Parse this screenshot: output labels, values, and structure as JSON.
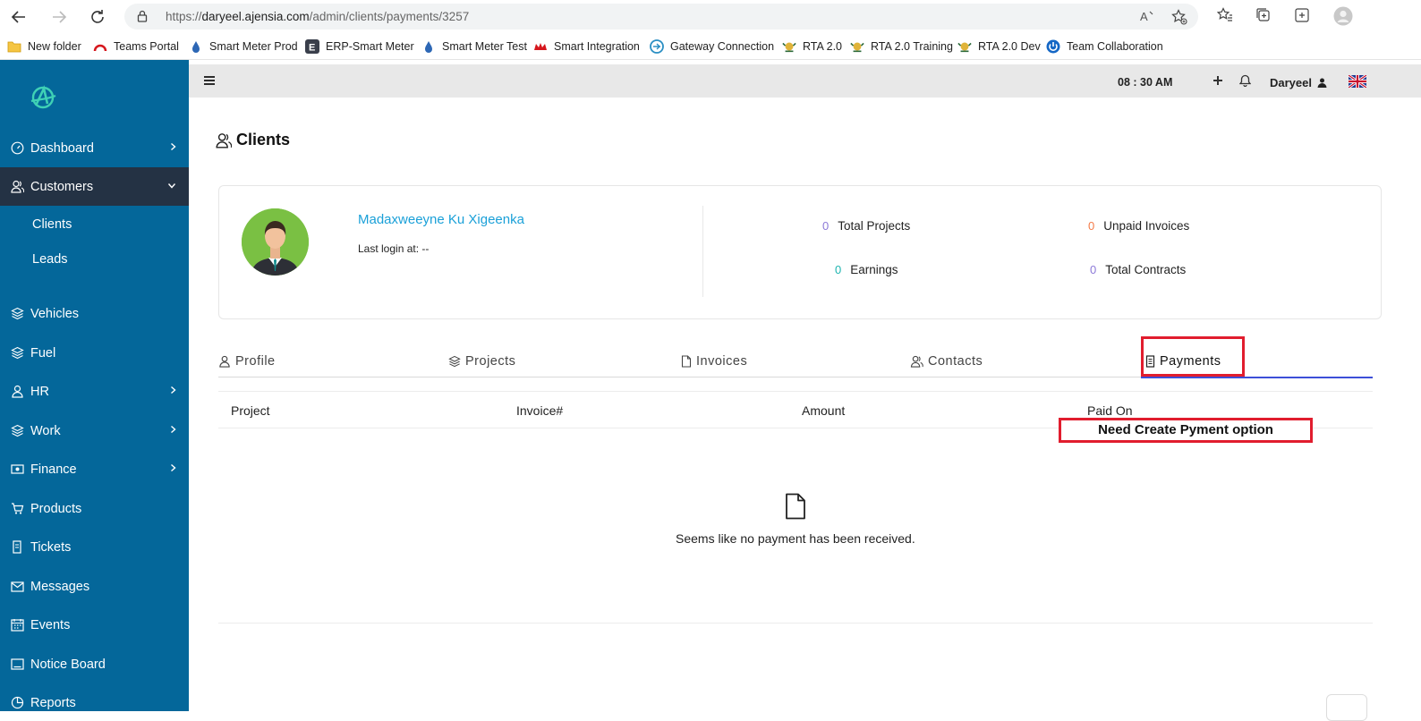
{
  "browser": {
    "url_scheme": "https://",
    "url_host": "daryeel.ajensia.com",
    "url_path": "/admin/clients/payments/3257"
  },
  "bookmarks": [
    {
      "label": "New folder",
      "icon": "folder-icon"
    },
    {
      "label": "Teams Portal",
      "icon": "teams-portal-icon"
    },
    {
      "label": "Smart Meter Prod",
      "icon": "drop-icon"
    },
    {
      "label": "ERP-Smart Meter",
      "icon": "e-badge-icon"
    },
    {
      "label": "Smart Meter Test",
      "icon": "drop-icon"
    },
    {
      "label": "Smart Integration",
      "icon": "crown-icon"
    },
    {
      "label": "Gateway Connection",
      "icon": "gateway-icon"
    },
    {
      "label": "RTA 2.0",
      "icon": "crest-icon"
    },
    {
      "label": "RTA 2.0 Training",
      "icon": "crest-icon"
    },
    {
      "label": "RTA 2.0 Dev",
      "icon": "crest-icon"
    },
    {
      "label": "Team Collaboration",
      "icon": "power-icon"
    }
  ],
  "sidebar": {
    "items": [
      {
        "label": "Dashboard",
        "icon": "gauge-icon",
        "has_chevron": true
      },
      {
        "label": "Customers",
        "icon": "users-icon",
        "has_chevron": true,
        "active": true
      },
      {
        "label": "Vehicles",
        "icon": "layers-icon"
      },
      {
        "label": "Fuel",
        "icon": "layers-icon"
      },
      {
        "label": "HR",
        "icon": "user-icon",
        "has_chevron": true
      },
      {
        "label": "Work",
        "icon": "layers-icon",
        "has_chevron": true
      },
      {
        "label": "Finance",
        "icon": "cash-icon",
        "has_chevron": true
      },
      {
        "label": "Products",
        "icon": "cart-icon"
      },
      {
        "label": "Tickets",
        "icon": "ticket-icon"
      },
      {
        "label": "Messages",
        "icon": "mail-icon"
      },
      {
        "label": "Events",
        "icon": "calendar-icon"
      },
      {
        "label": "Notice Board",
        "icon": "board-icon"
      },
      {
        "label": "Reports",
        "icon": "pie-icon"
      }
    ],
    "sub_items": [
      {
        "label": "Clients"
      },
      {
        "label": "Leads"
      }
    ]
  },
  "header": {
    "time": "08 : 30 AM",
    "user": "Daryeel"
  },
  "page": {
    "title": "Clients"
  },
  "client": {
    "name": "Madaxweeyne Ku Xigeenka",
    "last_login": "Last login at: --",
    "stats": {
      "total_projects": {
        "value": "0",
        "label": "Total Projects"
      },
      "unpaid_invoices": {
        "value": "0",
        "label": "Unpaid Invoices"
      },
      "earnings": {
        "value": "0",
        "label": "Earnings"
      },
      "total_contracts": {
        "value": "0",
        "label": "Total Contracts"
      }
    }
  },
  "tabs": [
    {
      "label": "Profile",
      "icon": "user-icon"
    },
    {
      "label": "Projects",
      "icon": "layers-icon"
    },
    {
      "label": "Invoices",
      "icon": "file-icon"
    },
    {
      "label": "Contacts",
      "icon": "users-icon"
    },
    {
      "label": "Payments",
      "icon": "receipt-icon",
      "active": true
    }
  ],
  "table": {
    "columns": [
      "Project",
      "Invoice#",
      "Amount",
      "Paid On"
    ]
  },
  "annotation": "Need Create Pyment option",
  "empty_state": {
    "message": "Seems like no payment has been received."
  },
  "colors": {
    "sidebar": "#04679a",
    "sidebar_active": "#243244",
    "highlight": "#e11d2e",
    "tab_underline": "#3d4fd8",
    "link": "#1aa0d8"
  }
}
